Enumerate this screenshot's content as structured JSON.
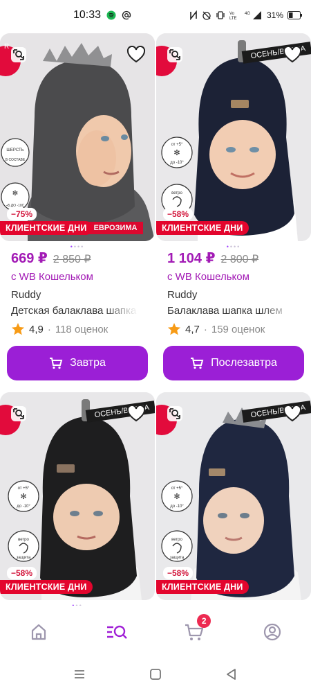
{
  "status_bar": {
    "time": "10:33",
    "battery": "31%",
    "network": "4G"
  },
  "products": [
    {
      "price": "669 ₽",
      "old_price": "2 850 ₽",
      "wallet": "с WB Кошельком",
      "brand": "Ruddy",
      "name": "Детская балаклава шапка",
      "rating": "4,9",
      "reviews": "118 оценок",
      "delivery": "Завтра",
      "discount": "−75%",
      "promo": "КЛИЕНТСКИЕ ДНИ",
      "promo_extra": "ЕВРОЗИМА",
      "season": "",
      "hat_color": "#4b4b4d"
    },
    {
      "price": "1 104 ₽",
      "old_price": "2 800 ₽",
      "wallet": "с WB Кошельком",
      "brand": "Ruddy",
      "name": "Балаклава шапка шлем",
      "rating": "4,7",
      "reviews": "159 оценок",
      "delivery": "Послезавтра",
      "discount": "−58%",
      "promo": "КЛИЕНТСКИЕ ДНИ",
      "promo_extra": "",
      "season": "ОСЕНЬ/ВЕСНА",
      "hat_color": "#1c2236"
    },
    {
      "discount": "−58%",
      "promo": "КЛИЕНТСКИЕ ДНИ",
      "season": "ОСЕНЬ/ВЕСНА",
      "hat_color": "#1e1e1f"
    },
    {
      "discount": "−58%",
      "promo": "КЛИЕНТСКИЕ ДНИ",
      "season": "ОСЕНЬ/ВЕСНА",
      "hat_color": "#1f2740"
    }
  ],
  "badges": {
    "wool": "ШЕРСТЬ В СОСТАВЕ",
    "temp_a": "+5 ДО -10С",
    "temp_b_top": "от +5°",
    "temp_b_bottom": "до -10°",
    "wind": "ветро защита"
  },
  "cart_count": "2",
  "colors": {
    "accent": "#9b1fd6",
    "price": "#a21ab5",
    "promo": "#e3052d"
  }
}
